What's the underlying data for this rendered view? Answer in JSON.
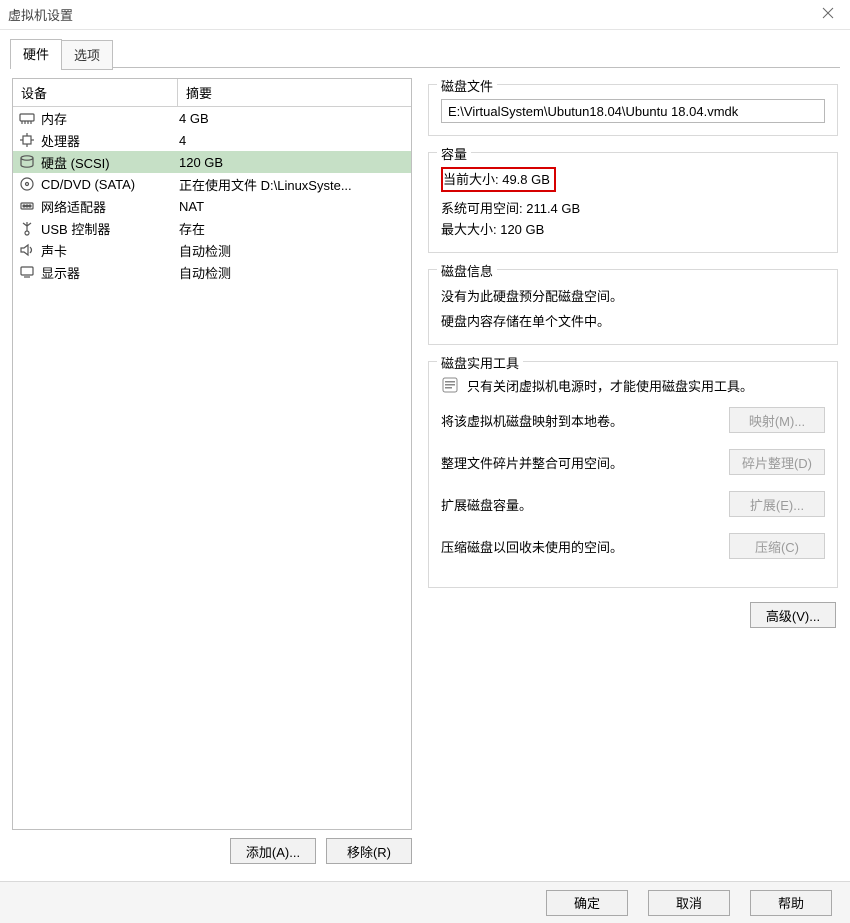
{
  "window": {
    "title": "虚拟机设置"
  },
  "tabs": {
    "hardware": "硬件",
    "options": "选项"
  },
  "table": {
    "headers": {
      "device": "设备",
      "summary": "摘要"
    },
    "rows": [
      {
        "icon": "memory",
        "name": "内存",
        "summary": "4 GB"
      },
      {
        "icon": "cpu",
        "name": "处理器",
        "summary": "4"
      },
      {
        "icon": "disk",
        "name": "硬盘 (SCSI)",
        "summary": "120 GB",
        "selected": true
      },
      {
        "icon": "cd",
        "name": "CD/DVD (SATA)",
        "summary": "正在使用文件 D:\\LinuxSyste..."
      },
      {
        "icon": "net",
        "name": "网络适配器",
        "summary": "NAT"
      },
      {
        "icon": "usb",
        "name": "USB 控制器",
        "summary": "存在"
      },
      {
        "icon": "sound",
        "name": "声卡",
        "summary": "自动检测"
      },
      {
        "icon": "display",
        "name": "显示器",
        "summary": "自动检测"
      }
    ]
  },
  "left_buttons": {
    "add": "添加(A)...",
    "remove": "移除(R)"
  },
  "right": {
    "disk_file": {
      "legend": "磁盘文件",
      "path": "E:\\VirtualSystem\\Ubutun18.04\\Ubuntu 18.04.vmdk"
    },
    "capacity": {
      "legend": "容量",
      "current": "当前大小: 49.8 GB",
      "free": "系统可用空间: 211.4 GB",
      "max": "最大大小: 120 GB"
    },
    "disk_info": {
      "legend": "磁盘信息",
      "line1": "没有为此硬盘预分配磁盘空间。",
      "line2": "硬盘内容存储在单个文件中。"
    },
    "disk_tools": {
      "legend": "磁盘实用工具",
      "hint": "只有关闭虚拟机电源时，才能使用磁盘实用工具。",
      "rows": [
        {
          "desc": "将该虚拟机磁盘映射到本地卷。",
          "btn": "映射(M)..."
        },
        {
          "desc": "整理文件碎片并整合可用空间。",
          "btn": "碎片整理(D)"
        },
        {
          "desc": "扩展磁盘容量。",
          "btn": "扩展(E)..."
        },
        {
          "desc": "压缩磁盘以回收未使用的空间。",
          "btn": "压缩(C)"
        }
      ]
    },
    "advanced": "高级(V)..."
  },
  "footer": {
    "ok": "确定",
    "cancel": "取消",
    "help": "帮助"
  }
}
